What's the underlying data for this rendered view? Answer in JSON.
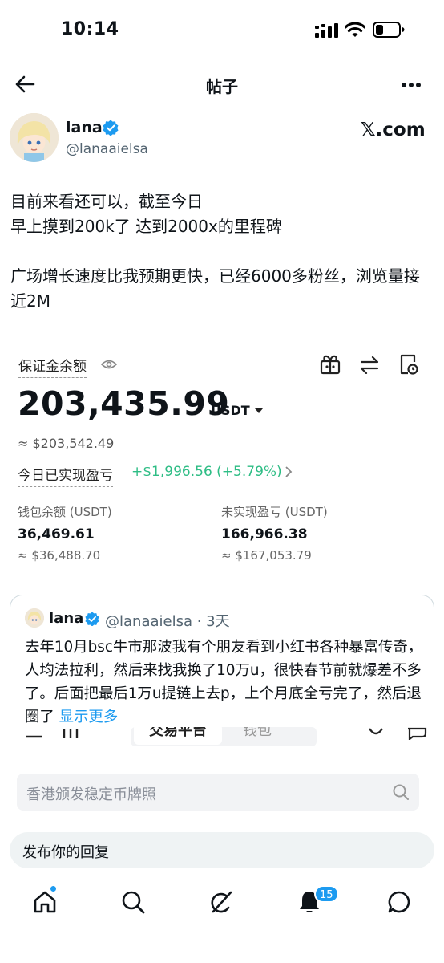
{
  "status_bar": {
    "time": "10:14"
  },
  "nav": {
    "title": "帖子"
  },
  "author": {
    "name": "lana",
    "handle": "@lanaaielsa",
    "watermark": "𝕏.com"
  },
  "post": {
    "text": "目前来看还可以，截至今日\n早上摸到200k了  达到2000x的里程碑\n\n广场增长速度比我预期更快，已经6000多粉丝，浏览量接近2M"
  },
  "embedded_image": {
    "label": "保证金余额",
    "balance": "203,435.99",
    "currency": "USDT",
    "approx": "≈ $203,542.49",
    "pnl_label": "今日已实现盈亏",
    "pnl_value": "+$1,996.56 (+5.79%)",
    "stats": [
      {
        "label": "钱包余额 (USDT)",
        "value": "36,469.61",
        "sub": "≈ $36,488.70"
      },
      {
        "label": "未实现盈亏 (USDT)",
        "value": "166,966.38",
        "sub": "≈ $167,053.79"
      }
    ],
    "pnl_color": "#2ebd85"
  },
  "quote": {
    "name": "lana",
    "handle": "@lanaaielsa · 3天",
    "text": "去年10月bsc牛市那波我有个朋友看到小红书各种暴富传奇，人均法拉利，然后来找我换了10万u，很快春节前就爆差不多了。后面把最后1万u提链上去p，上个月底全亏完了，然后退圈了 ",
    "more": "显示更多",
    "shot": {
      "tab_active": "交易平台",
      "tab_other": "钱包",
      "search_placeholder": "香港颁发稳定币牌照"
    }
  },
  "reply": {
    "placeholder": "发布你的回复"
  },
  "tabbar": {
    "items": [
      "home-icon",
      "search-icon",
      "grok-icon",
      "notifications-icon",
      "messages-icon"
    ],
    "notification_count": "15"
  },
  "colors": {
    "accent": "#1d9bf0",
    "text": "#0f1419",
    "muted": "#536471"
  }
}
